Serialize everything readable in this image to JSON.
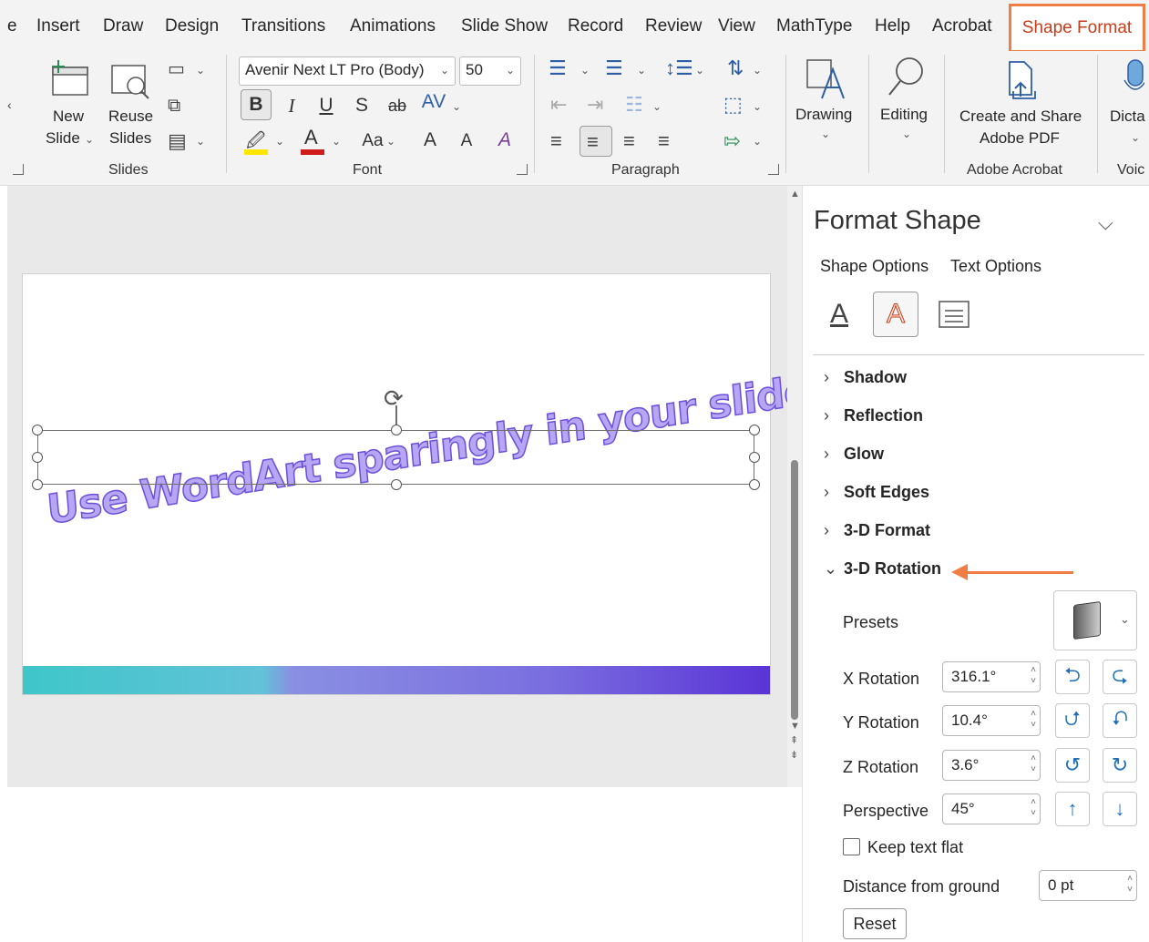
{
  "menu": {
    "items": [
      "e",
      "Insert",
      "Draw",
      "Design",
      "Transitions",
      "Animations",
      "Slide Show",
      "Record",
      "Review",
      "View",
      "MathType",
      "Help",
      "Acrobat"
    ],
    "active_tab": "Shape Format"
  },
  "ribbon": {
    "slides": {
      "new_slide_line1": "New",
      "new_slide_line2": "Slide",
      "reuse_line1": "Reuse",
      "reuse_line2": "Slides",
      "group": "Slides"
    },
    "font": {
      "name": "Avenir Next LT Pro (Body)",
      "size": "50",
      "bold": "B",
      "italic": "I",
      "underline": "U",
      "shadow": "S",
      "strike": "ab",
      "spacing": "AV",
      "highlight": "🖉",
      "color": "A",
      "case": "Aa",
      "grow": "A",
      "shrink": "A",
      "clear": "A",
      "group": "Font"
    },
    "paragraph": {
      "group": "Paragraph"
    },
    "drawing": {
      "label": "Drawing"
    },
    "editing": {
      "label": "Editing"
    },
    "acrobat": {
      "line1": "Create and Share",
      "line2": "Adobe PDF",
      "group": "Adobe Acrobat"
    },
    "voice": {
      "label": "Dicta",
      "group": "Voic"
    }
  },
  "slide": {
    "wordart_text": "Use WordArt sparingly in your slides."
  },
  "pane": {
    "title": "Format Shape",
    "tab_shape": "Shape Options",
    "tab_text": "Text Options",
    "sections": {
      "shadow": "Shadow",
      "reflection": "Reflection",
      "glow": "Glow",
      "soft_edges": "Soft Edges",
      "format_3d": "3-D Format",
      "rotation_3d": "3-D Rotation"
    },
    "presets_label": "Presets",
    "x_label": "X Rotation",
    "x_value": "316.1°",
    "y_label": "Y Rotation",
    "y_value": "10.4°",
    "z_label": "Z Rotation",
    "z_value": "3.6°",
    "perspective_label": "Perspective",
    "perspective_value": "45°",
    "keep_flat_label": "Keep text flat",
    "distance_label": "Distance from ground",
    "distance_value": "0 pt",
    "reset_label": "Reset"
  },
  "colors": {
    "accent_orange": "#ef7d44",
    "wordart_fill": "#b7a6f4",
    "wordart_outline": "#6d4fdb"
  }
}
